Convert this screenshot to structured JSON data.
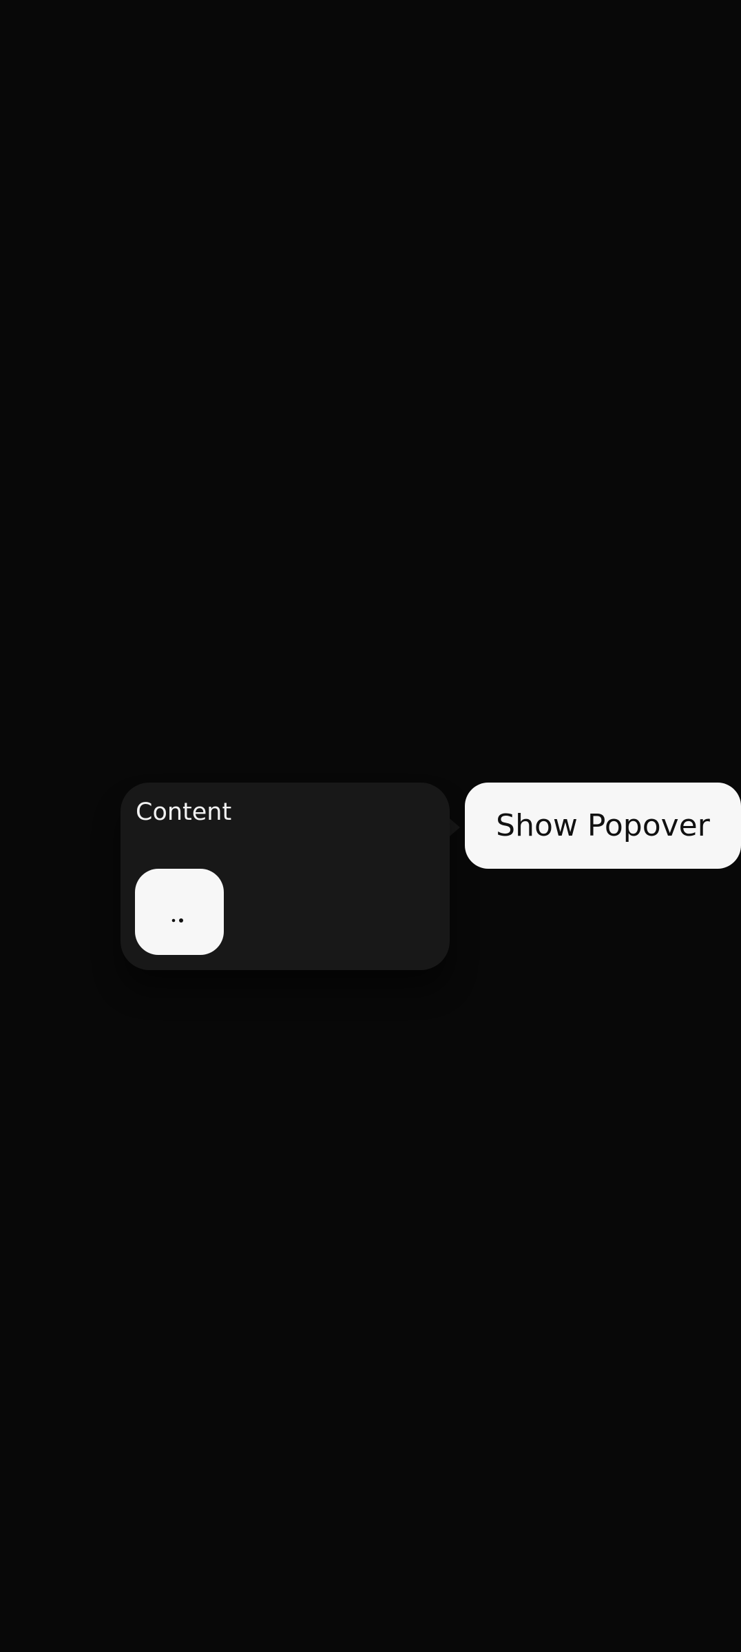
{
  "popover": {
    "title": "Content",
    "action_icon": "more-horizontal-icon"
  },
  "actions": {
    "show_popover_label": "Show Popover"
  },
  "colors": {
    "background": "#080808",
    "popover_background": "#181818",
    "button_background": "#f7f7f7",
    "button_text": "#111111",
    "popover_text": "#f2f2f2"
  }
}
